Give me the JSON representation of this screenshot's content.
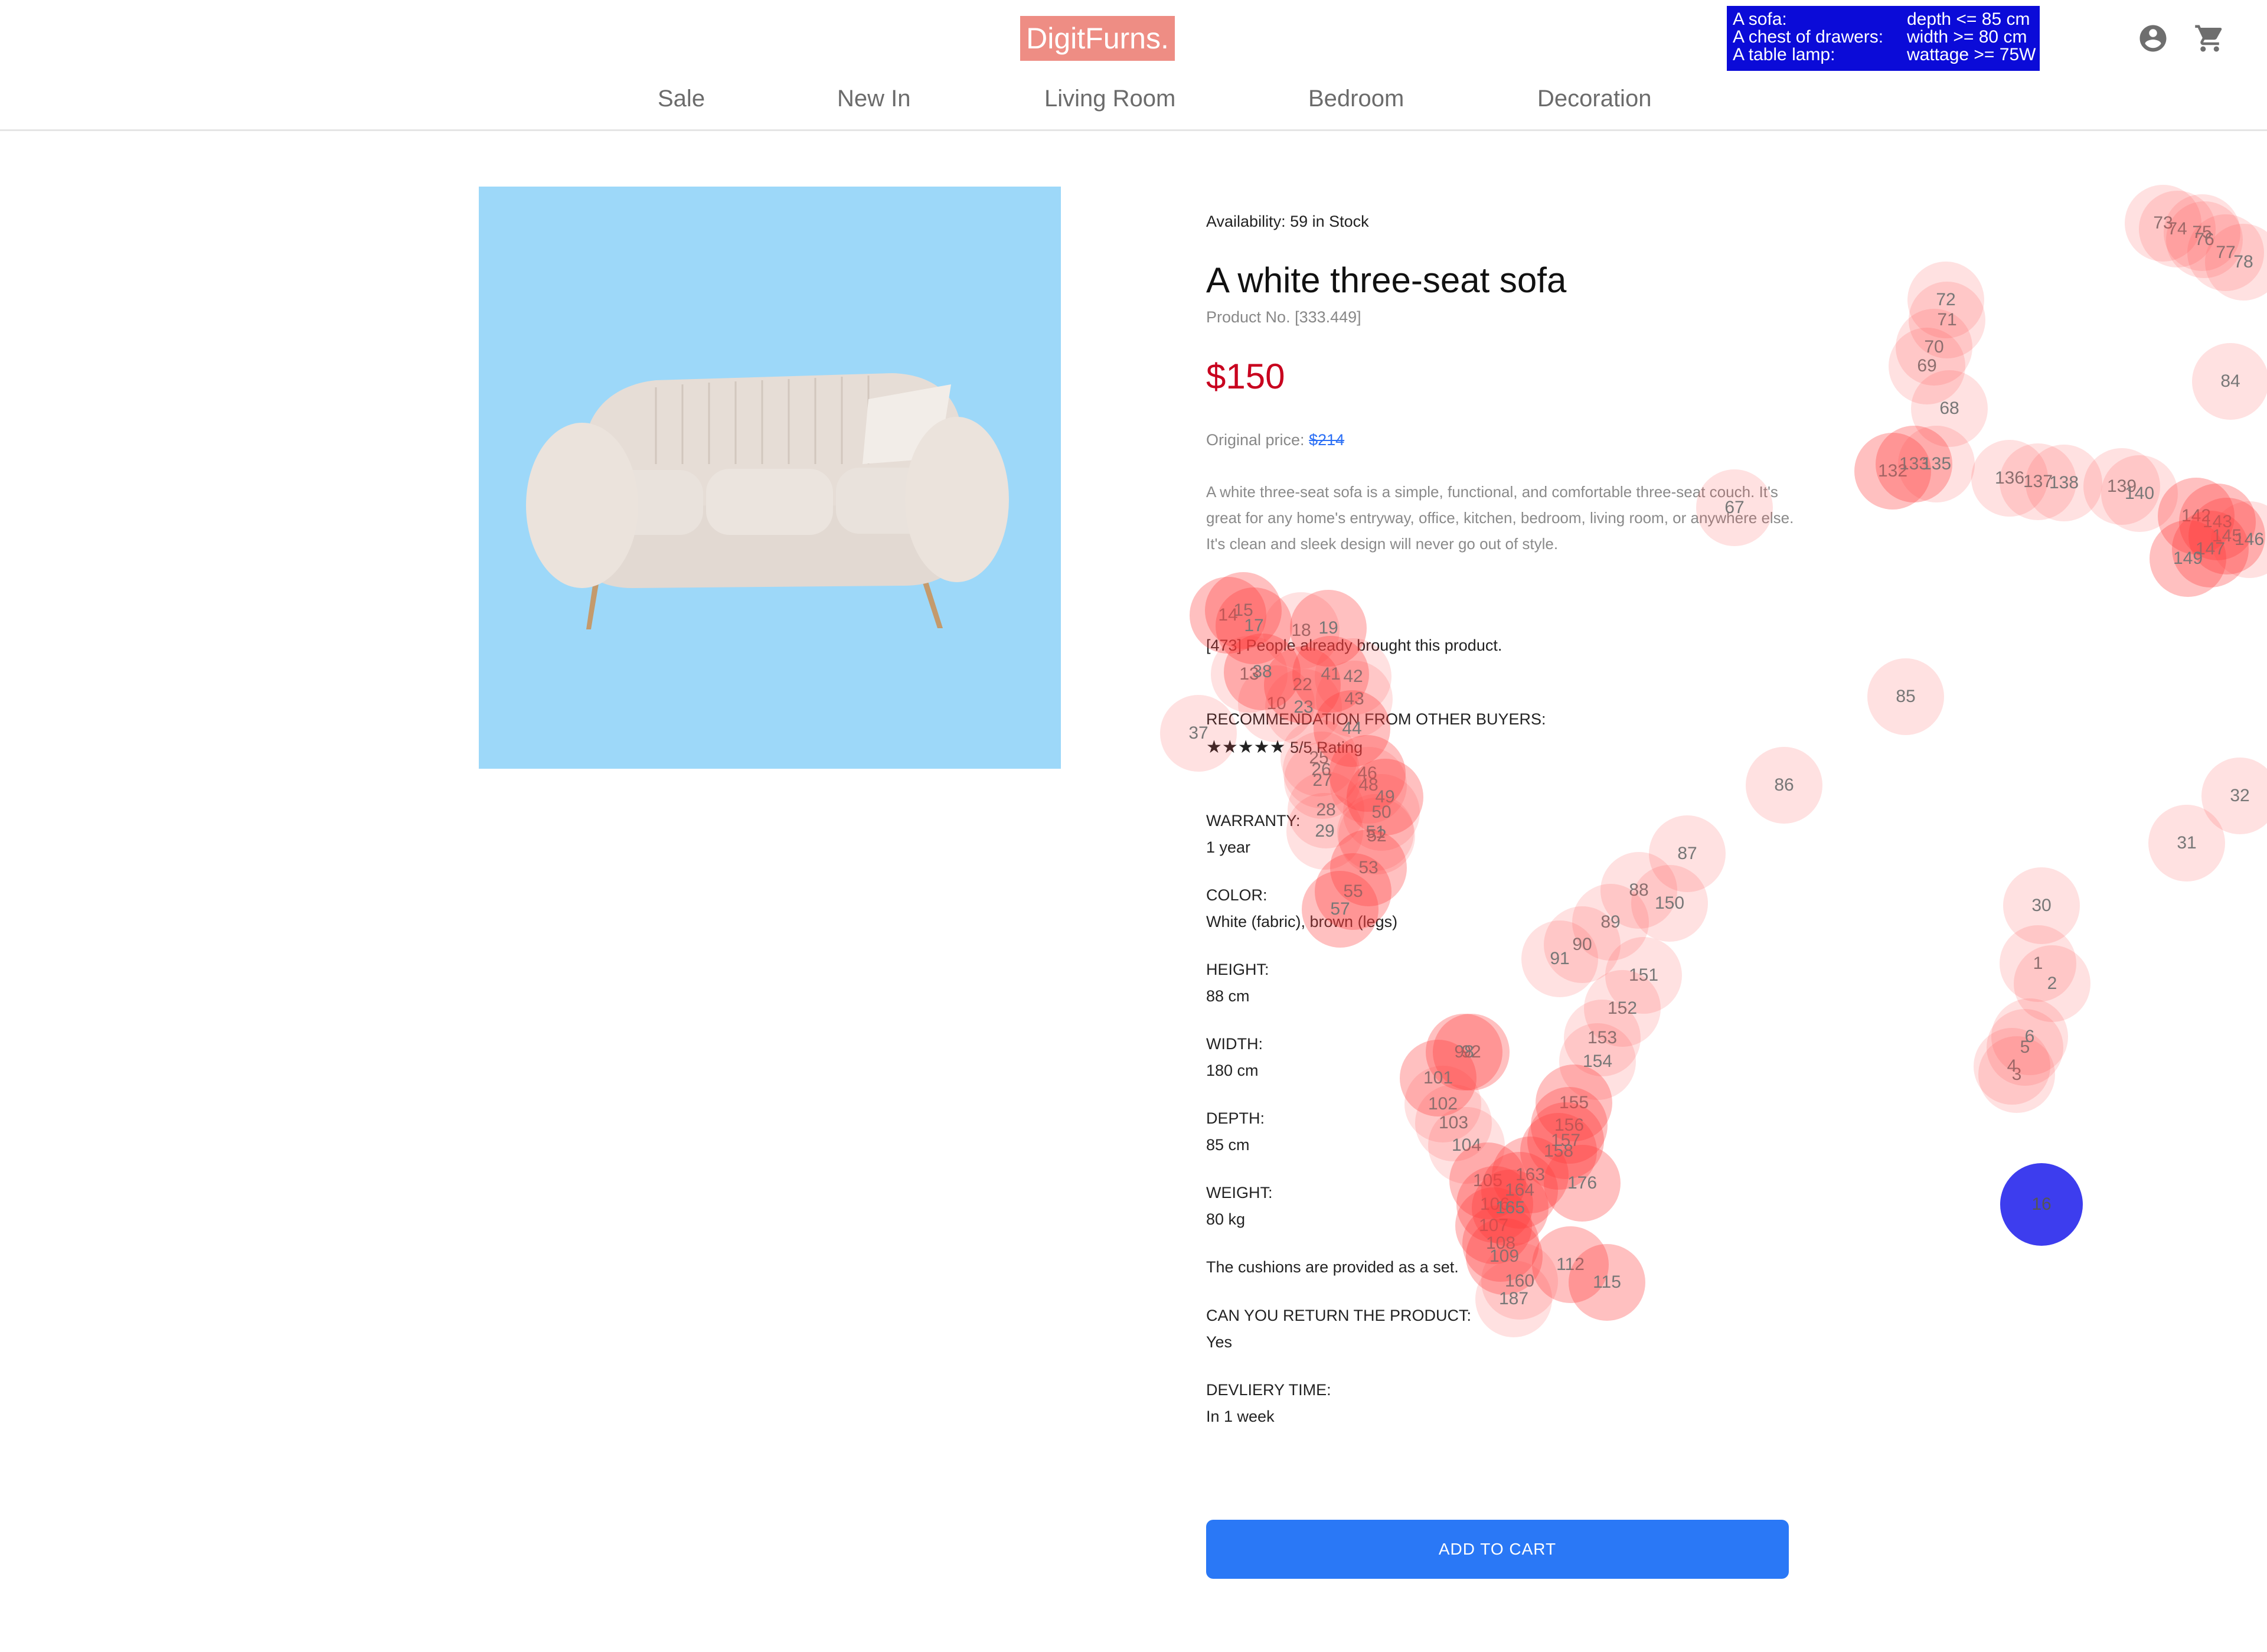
{
  "header": {
    "logo": "DigitFurns.",
    "goals": [
      {
        "item": "A sofa:",
        "constraint": "depth <= 85 cm"
      },
      {
        "item": "A chest of drawers:",
        "constraint": "width >= 80 cm"
      },
      {
        "item": "A table lamp:",
        "constraint": "wattage >= 75W"
      }
    ],
    "account_icon": "account-circle-icon",
    "cart_icon": "shopping-cart-icon",
    "nav": [
      "Sale",
      "New In",
      "Living Room",
      "Bedroom",
      "Decoration"
    ]
  },
  "product": {
    "image_subject": "white three-seat sofa on light blue background",
    "availability": "Availability: 59 in Stock",
    "title": "A white three-seat sofa",
    "product_no": "Product No. [333.449]",
    "price": "$150",
    "original_price_label": "Original price:",
    "original_price": "$214",
    "description": "A white three-seat sofa is a simple, functional, and comfortable three-seat couch. It's great for any home's entryway, office, kitchen, bedroom, living room, or anywhere else. It's clean and sleek design will never go out of style.",
    "bought": "[473] People already brought this product.",
    "recommendation_label": "RECOMMENDATION FROM OTHER BUYERS:",
    "stars": "★★★★★",
    "rating": "5/5 Rating",
    "warranty_label": "WARRANTY:",
    "warranty": "1 year",
    "color_label": "COLOR:",
    "color": "White (fabric), brown (legs)",
    "height_label": "HEIGHT:",
    "height": "88 cm",
    "width_label": "WIDTH:",
    "width": "180 cm",
    "depth_label": "DEPTH:",
    "depth": "85 cm",
    "weight_label": "WEIGHT:",
    "weight": "80 kg",
    "cushions": "The cushions are provided as a set.",
    "return_label": "CAN YOU RETURN THE PRODUCT:",
    "return_value": "Yes",
    "delivery_label": "DEVLIERY TIME:",
    "delivery": "In 1 week",
    "add_to_cart": "ADD TO CART"
  },
  "overlay": {
    "colors": {
      "trail": "#ff4646",
      "current": "#3d3dee"
    },
    "markers": [
      {
        "n": "1"
      },
      {
        "n": "2"
      },
      {
        "n": "3"
      },
      {
        "n": "4"
      },
      {
        "n": "5"
      },
      {
        "n": "6"
      },
      {
        "n": "10"
      },
      {
        "n": "13"
      },
      {
        "n": "14"
      },
      {
        "n": "15"
      },
      {
        "n": "17"
      },
      {
        "n": "18"
      },
      {
        "n": "19"
      },
      {
        "n": "22"
      },
      {
        "n": "23"
      },
      {
        "n": "25"
      },
      {
        "n": "26"
      },
      {
        "n": "27"
      },
      {
        "n": "28"
      },
      {
        "n": "29"
      },
      {
        "n": "30"
      },
      {
        "n": "31"
      },
      {
        "n": "32"
      },
      {
        "n": "37"
      },
      {
        "n": "38"
      },
      {
        "n": "41"
      },
      {
        "n": "42"
      },
      {
        "n": "43"
      },
      {
        "n": "44"
      },
      {
        "n": "46"
      },
      {
        "n": "48"
      },
      {
        "n": "49"
      },
      {
        "n": "50"
      },
      {
        "n": "51"
      },
      {
        "n": "52"
      },
      {
        "n": "53"
      },
      {
        "n": "55"
      },
      {
        "n": "57"
      },
      {
        "n": "67"
      },
      {
        "n": "68"
      },
      {
        "n": "69"
      },
      {
        "n": "70"
      },
      {
        "n": "71"
      },
      {
        "n": "72"
      },
      {
        "n": "73"
      },
      {
        "n": "74"
      },
      {
        "n": "75"
      },
      {
        "n": "76"
      },
      {
        "n": "77"
      },
      {
        "n": "78"
      },
      {
        "n": "84"
      },
      {
        "n": "85"
      },
      {
        "n": "86"
      },
      {
        "n": "87"
      },
      {
        "n": "88"
      },
      {
        "n": "89"
      },
      {
        "n": "90"
      },
      {
        "n": "91"
      },
      {
        "n": "92"
      },
      {
        "n": "98"
      },
      {
        "n": "101"
      },
      {
        "n": "102"
      },
      {
        "n": "103"
      },
      {
        "n": "104"
      },
      {
        "n": "105"
      },
      {
        "n": "106"
      },
      {
        "n": "107"
      },
      {
        "n": "108"
      },
      {
        "n": "109"
      },
      {
        "n": "112"
      },
      {
        "n": "115"
      },
      {
        "n": "132"
      },
      {
        "n": "133"
      },
      {
        "n": "135"
      },
      {
        "n": "136"
      },
      {
        "n": "137"
      },
      {
        "n": "138"
      },
      {
        "n": "139"
      },
      {
        "n": "140"
      },
      {
        "n": "142"
      },
      {
        "n": "143"
      },
      {
        "n": "145"
      },
      {
        "n": "146"
      },
      {
        "n": "147"
      },
      {
        "n": "149"
      },
      {
        "n": "150"
      },
      {
        "n": "151"
      },
      {
        "n": "152"
      },
      {
        "n": "153"
      },
      {
        "n": "154"
      },
      {
        "n": "155"
      },
      {
        "n": "156"
      },
      {
        "n": "157"
      },
      {
        "n": "158"
      },
      {
        "n": "160"
      },
      {
        "n": "163"
      },
      {
        "n": "164"
      },
      {
        "n": "165"
      },
      {
        "n": "176"
      },
      {
        "n": "187"
      },
      {
        "n": "16",
        "current": true
      }
    ]
  }
}
